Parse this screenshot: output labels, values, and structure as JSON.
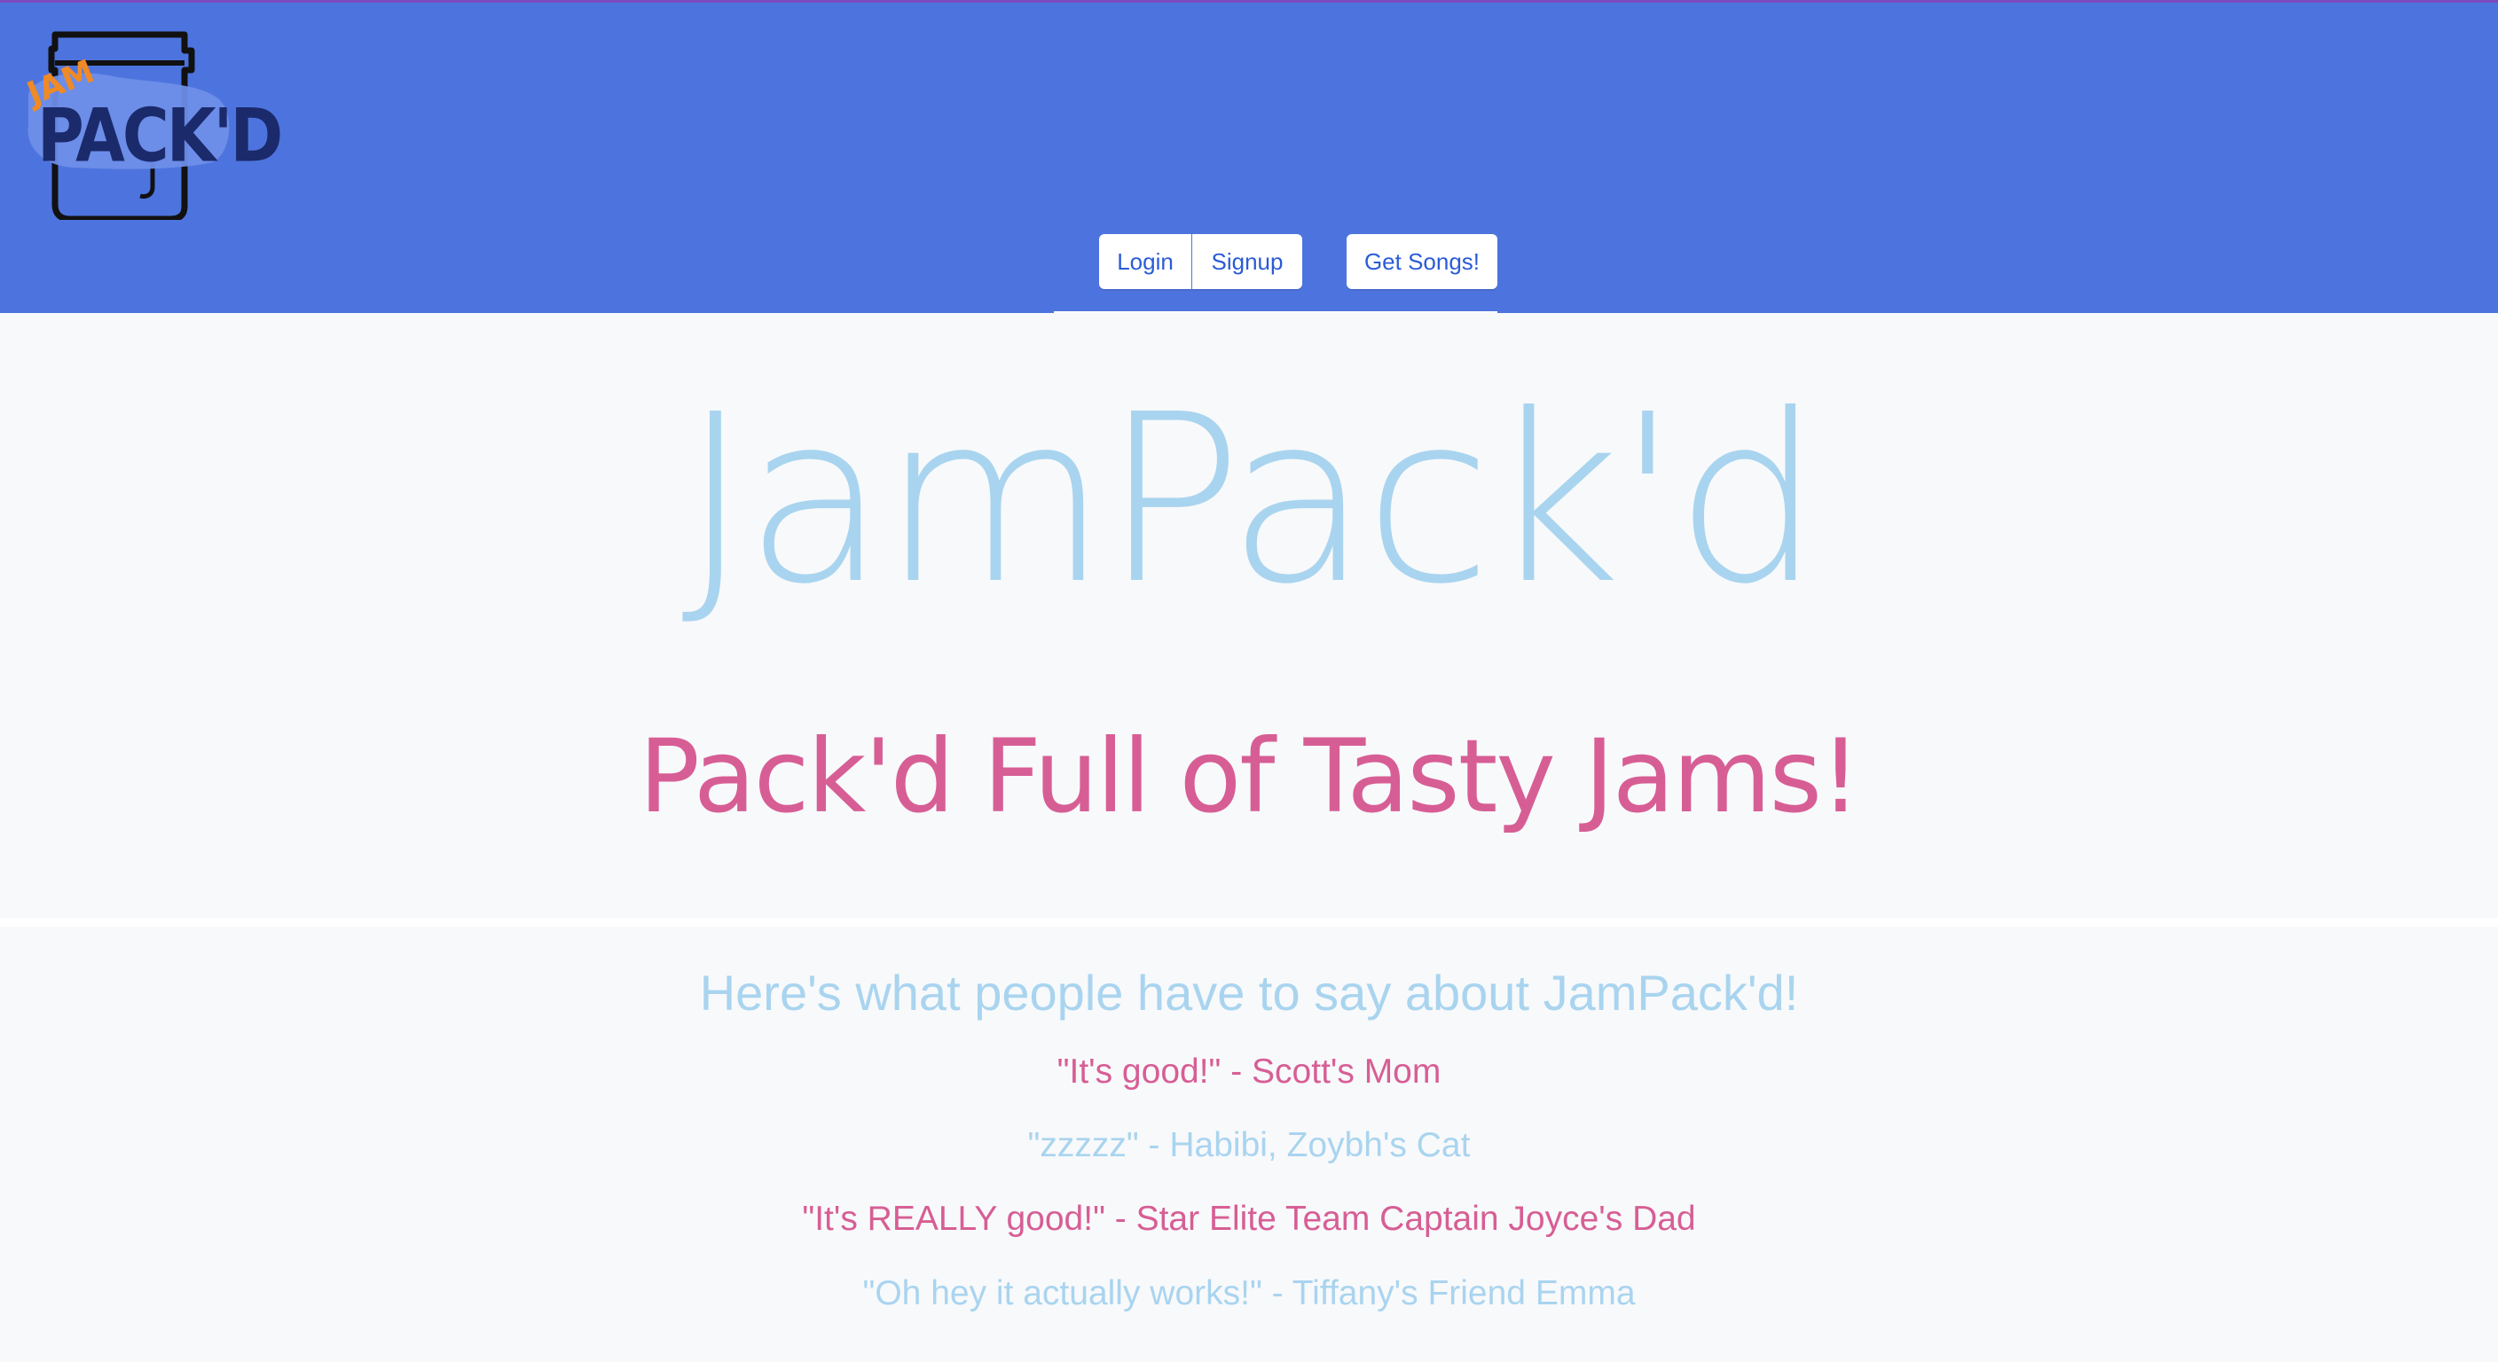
{
  "header": {
    "logo": {
      "small_text": "JAM",
      "big_text": "PACK'D"
    },
    "nav": {
      "login_label": "Login",
      "signup_label": "Signup",
      "songs_label": "Get Songs!"
    }
  },
  "hero": {
    "title": "JamPack'd",
    "subtitle": "Pack'd Full of Tasty Jams!"
  },
  "reviews": {
    "heading": "Here's what people have to say about JamPack'd!",
    "items": [
      "\"It's good!\" - Scott's Mom",
      "\"zzzzz\" - Habibi, Zoybh's Cat",
      "\"It's REALLY good!\" - Star Elite Team Captain Joyce's Dad",
      "\"Oh hey it actually works!\" - Tiffany's Friend Emma"
    ]
  },
  "colors": {
    "header_bg": "#4d74de",
    "accent_blue": "#a9d4ef",
    "accent_pink": "#d75e95",
    "logo_orange": "#f08a24",
    "logo_navy": "#1b2a6b"
  }
}
